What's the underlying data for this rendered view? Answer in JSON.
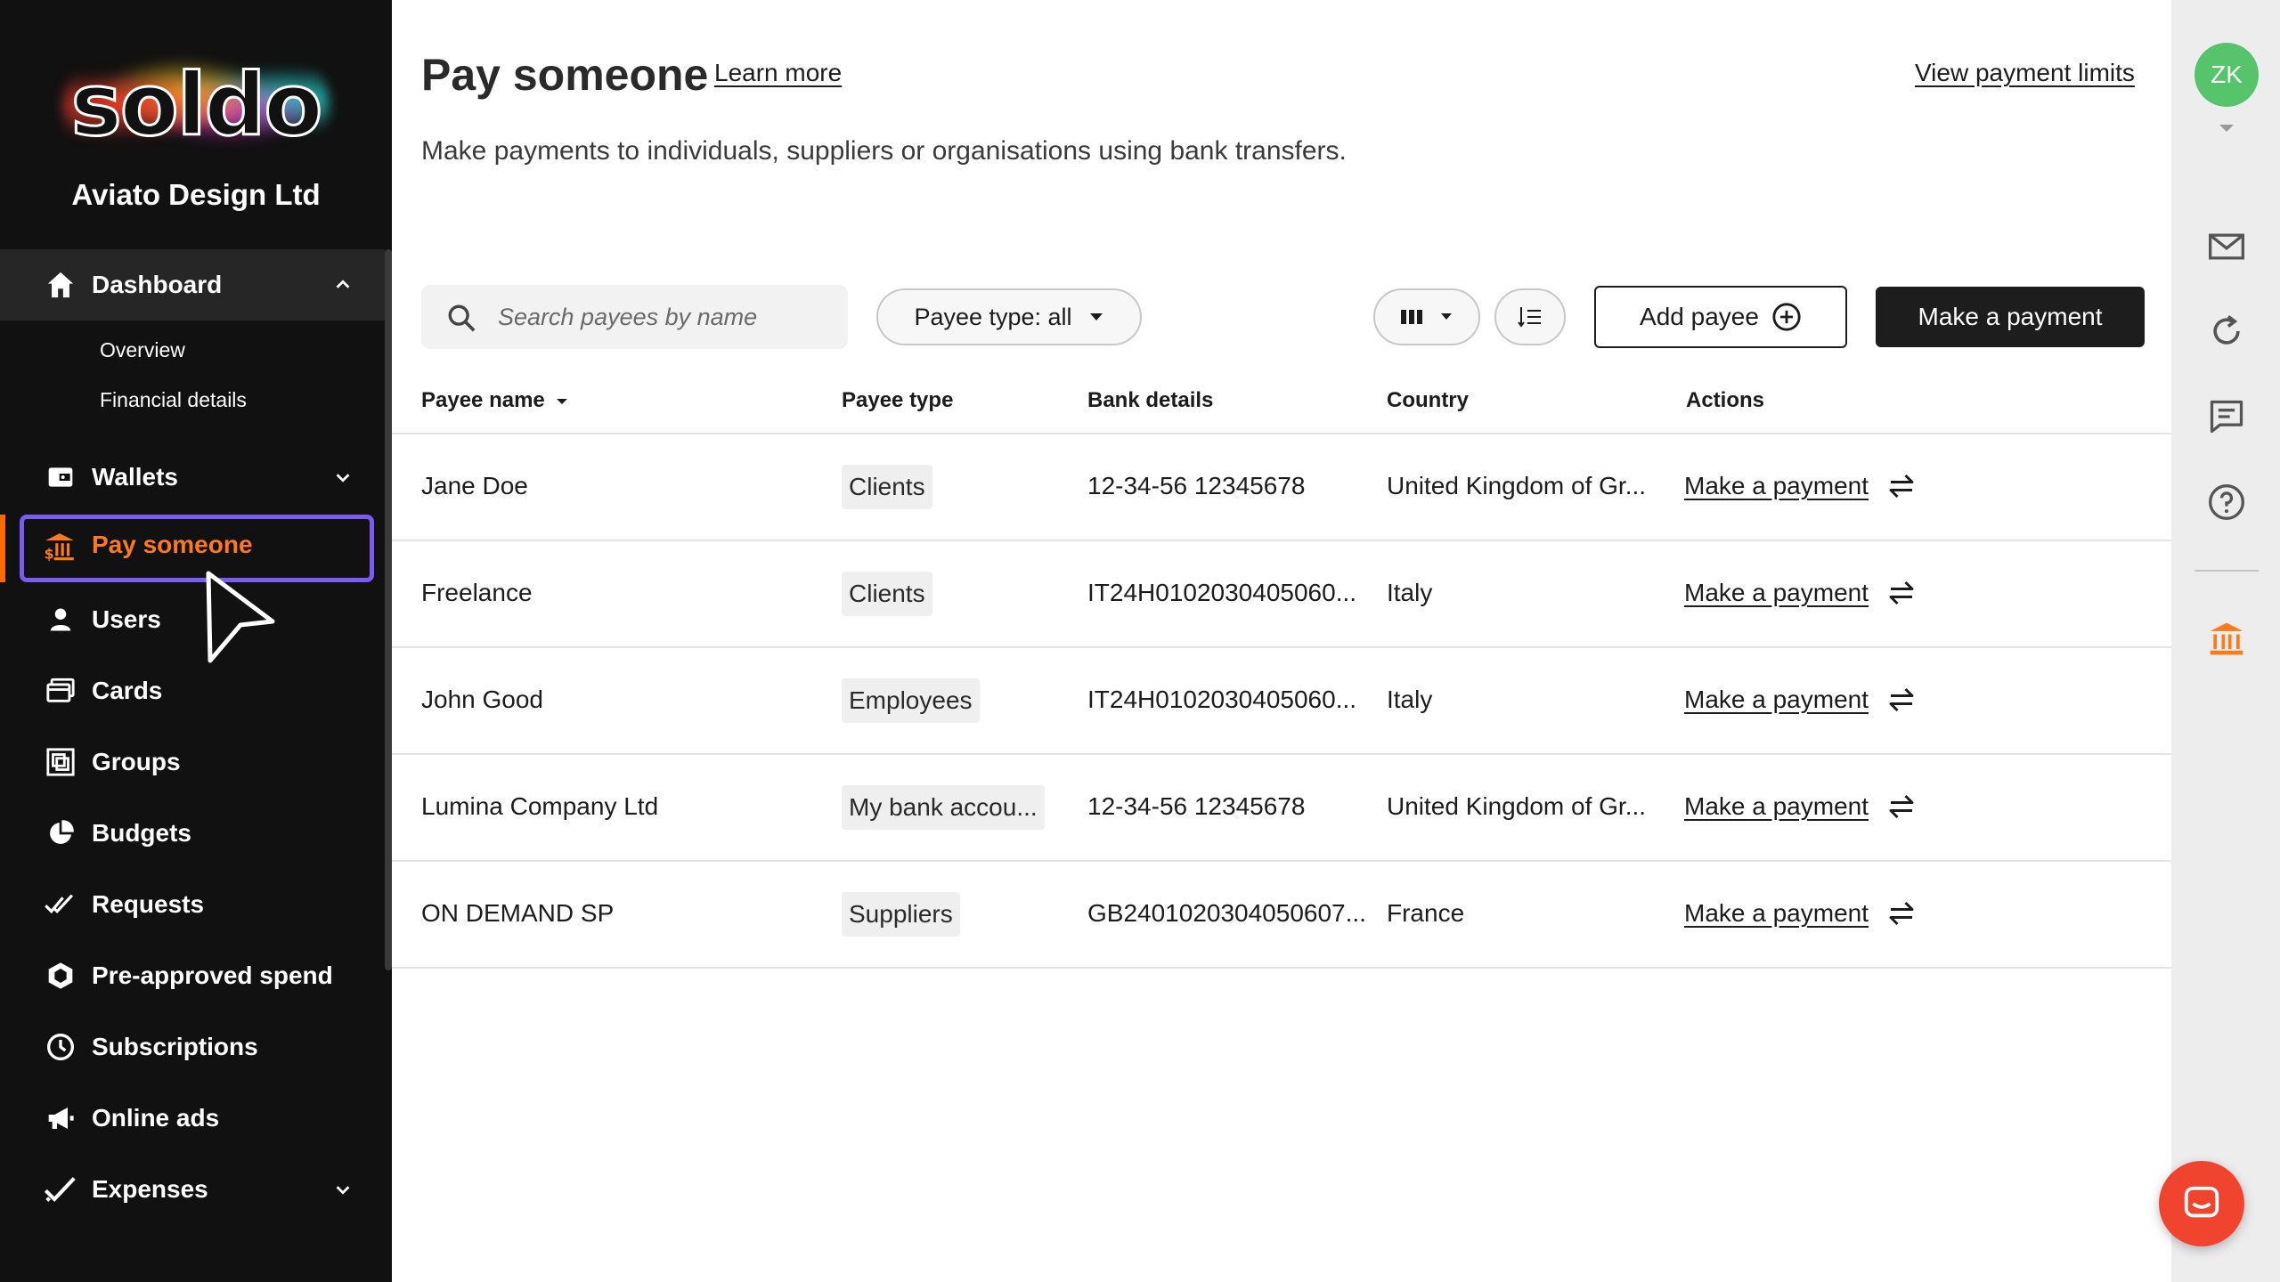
{
  "sidebar": {
    "logo": "soldo",
    "company": "Aviato Design Ltd",
    "dashboard": {
      "label": "Dashboard",
      "children": [
        "Overview",
        "Financial details"
      ]
    },
    "items": [
      {
        "label": "Wallets",
        "icon": "wallet-icon"
      },
      {
        "label": "Pay someone",
        "icon": "bank-transfer-icon",
        "active": true
      },
      {
        "label": "Users",
        "icon": "user-icon"
      },
      {
        "label": "Cards",
        "icon": "card-icon"
      },
      {
        "label": "Groups",
        "icon": "groups-icon"
      },
      {
        "label": "Budgets",
        "icon": "pie-icon"
      },
      {
        "label": "Requests",
        "icon": "double-check-icon"
      },
      {
        "label": "Pre-approved spend",
        "icon": "hexagon-icon"
      },
      {
        "label": "Subscriptions",
        "icon": "clock-icon"
      },
      {
        "label": "Online ads",
        "icon": "megaphone-icon"
      },
      {
        "label": "Expenses",
        "icon": "check-icon"
      }
    ]
  },
  "header": {
    "title": "Pay someone",
    "learn_more": "Learn more",
    "view_limits": "View payment limits",
    "subtitle": "Make payments to individuals, suppliers or organisations using bank transfers."
  },
  "toolbar": {
    "search_placeholder": "Search payees by name",
    "filter_label": "Payee type: all",
    "add_payee": "Add payee",
    "make_payment": "Make a payment"
  },
  "table": {
    "columns": [
      "Payee name",
      "Payee type",
      "Bank details",
      "Country",
      "Actions"
    ],
    "rows": [
      {
        "name": "Jane Doe",
        "type": "Clients",
        "bank": "12-34-56 12345678",
        "country": "United Kingdom of Gr...",
        "action": "Make a payment"
      },
      {
        "name": "Freelance",
        "type": "Clients",
        "bank": "IT24H0102030405060...",
        "country": "Italy",
        "action": "Make a payment"
      },
      {
        "name": "John Good",
        "type": "Employees",
        "bank": "IT24H0102030405060...",
        "country": "Italy",
        "action": "Make a payment"
      },
      {
        "name": "Lumina Company Ltd",
        "type": "My bank accou...",
        "bank": "12-34-56 12345678",
        "country": "United Kingdom of Gr...",
        "action": "Make a payment"
      },
      {
        "name": "ON DEMAND SP",
        "type": "Suppliers",
        "bank": "GB2401020304050607...",
        "country": "France",
        "action": "Make a payment"
      }
    ]
  },
  "rail": {
    "avatar_initials": "ZK",
    "icons": [
      "mail-icon",
      "refresh-icon",
      "chat-icon",
      "help-icon",
      "bank-icon"
    ]
  },
  "colors": {
    "accent": "#ff7a1a",
    "focus_outline": "#7a5cf0",
    "avatar": "#56c46b",
    "chat_fab": "#f0442f"
  }
}
